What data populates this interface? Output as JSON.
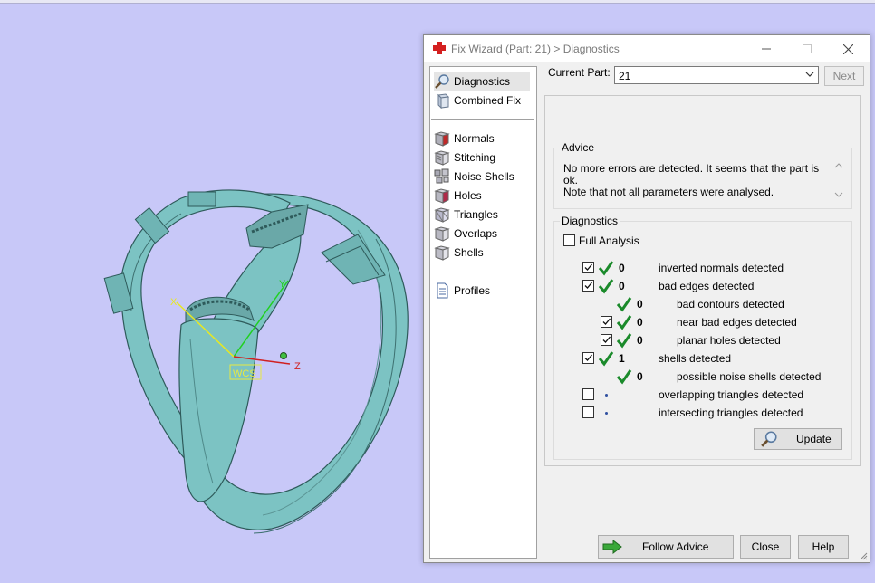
{
  "viewport": {
    "axis_x_label": "X",
    "axis_y_label": "Y",
    "axis_z_label": "Z",
    "wcs_label": "WCS",
    "model_color": "#7cc3c3"
  },
  "dialog": {
    "title": "Fix Wizard (Part: 21) > Diagnostics",
    "nav": {
      "top_items": [
        {
          "label": "Diagnostics",
          "icon": "magnifier-icon"
        },
        {
          "label": "Combined Fix",
          "icon": "combined-fix-icon"
        }
      ],
      "fix_items": [
        {
          "label": "Normals",
          "icon": "normals-cube-icon"
        },
        {
          "label": "Stitching",
          "icon": "stitching-cube-icon"
        },
        {
          "label": "Noise Shells",
          "icon": "noise-shells-icon"
        },
        {
          "label": "Holes",
          "icon": "holes-cube-icon"
        },
        {
          "label": "Triangles",
          "icon": "triangles-cube-icon"
        },
        {
          "label": "Overlaps",
          "icon": "overlaps-cube-icon"
        },
        {
          "label": "Shells",
          "icon": "shells-cube-icon"
        }
      ],
      "bottom_items": [
        {
          "label": "Profiles",
          "icon": "document-icon"
        }
      ]
    },
    "current_part_label": "Current Part:",
    "current_part_value": "21",
    "next_label": "Next",
    "advice": {
      "title": "Advice",
      "line1": "No more errors are detected. It seems that the part is ok.",
      "line2": "Note that not all parameters were analysed."
    },
    "diagnostics": {
      "title": "Diagnostics",
      "full_analysis_label": "Full Analysis",
      "full_analysis_checked": false,
      "rows": [
        {
          "label": "inverted normals detected",
          "count": "0",
          "checked": true,
          "status": "ok"
        },
        {
          "label": "bad edges detected",
          "count": "0",
          "checked": true,
          "status": "ok"
        },
        {
          "label": "bad contours detected",
          "count": "0",
          "checked": null,
          "status": "ok"
        },
        {
          "label": "near bad edges detected",
          "count": "0",
          "checked": true,
          "status": "ok"
        },
        {
          "label": "planar holes detected",
          "count": "0",
          "checked": true,
          "status": "ok"
        },
        {
          "label": "shells detected",
          "count": "1",
          "checked": true,
          "status": "ok"
        },
        {
          "label": "possible noise shells detected",
          "count": "0",
          "checked": null,
          "status": "ok"
        },
        {
          "label": "overlapping triangles detected",
          "count": "",
          "checked": false,
          "status": "pending"
        },
        {
          "label": "intersecting triangles detected",
          "count": "",
          "checked": false,
          "status": "pending"
        }
      ],
      "update_label": "Update"
    },
    "buttons": {
      "follow_advice": "Follow Advice",
      "close": "Close",
      "help": "Help"
    }
  }
}
